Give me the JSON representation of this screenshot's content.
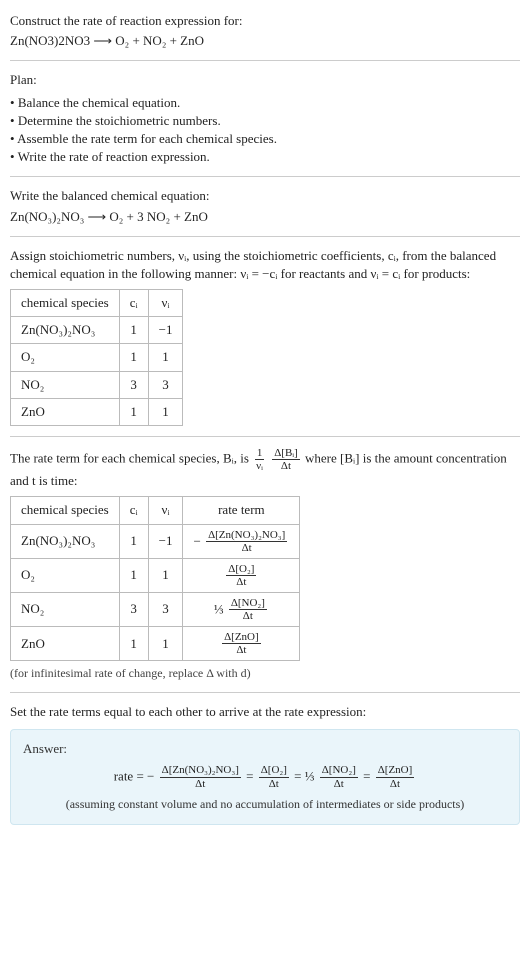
{
  "header": {
    "prompt": "Construct the rate of reaction expression for:",
    "equation_unbalanced": "Zn(NO3)2NO3  ⟶  O₂ + NO₂ + ZnO"
  },
  "plan": {
    "title": "Plan:",
    "items": [
      "Balance the chemical equation.",
      "Determine the stoichiometric numbers.",
      "Assemble the rate term for each chemical species.",
      "Write the rate of reaction expression."
    ]
  },
  "balanced": {
    "intro": "Write the balanced chemical equation:",
    "equation": "Zn(NO₃)₂NO₃  ⟶  O₂ + 3 NO₂ + ZnO"
  },
  "stoich_assign": {
    "text": "Assign stoichiometric numbers, νᵢ, using the stoichiometric coefficients, cᵢ, from the balanced chemical equation in the following manner: νᵢ = −cᵢ for reactants and νᵢ = cᵢ for products:",
    "headers": {
      "species": "chemical species",
      "ci": "cᵢ",
      "vi": "νᵢ"
    },
    "rows": [
      {
        "species": "Zn(NO₃)₂NO₃",
        "ci": "1",
        "vi": "−1"
      },
      {
        "species": "O₂",
        "ci": "1",
        "vi": "1"
      },
      {
        "species": "NO₂",
        "ci": "3",
        "vi": "3"
      },
      {
        "species": "ZnO",
        "ci": "1",
        "vi": "1"
      }
    ]
  },
  "rate_term": {
    "intro_1": "The rate term for each chemical species, Bᵢ, is ",
    "intro_2": " where [Bᵢ] is the amount concentration and t is time:",
    "frac1": {
      "num": "1",
      "den": "νᵢ"
    },
    "frac2": {
      "num": "Δ[Bᵢ]",
      "den": "Δt"
    },
    "headers": {
      "species": "chemical species",
      "ci": "cᵢ",
      "vi": "νᵢ",
      "rate": "rate term"
    },
    "rows": [
      {
        "species": "Zn(NO₃)₂NO₃",
        "ci": "1",
        "vi": "−1",
        "rate_prefix": "−",
        "rate_num": "Δ[Zn(NO₃)₂NO₃]",
        "rate_den": "Δt"
      },
      {
        "species": "O₂",
        "ci": "1",
        "vi": "1",
        "rate_prefix": "",
        "rate_num": "Δ[O₂]",
        "rate_den": "Δt"
      },
      {
        "species": "NO₂",
        "ci": "3",
        "vi": "3",
        "rate_prefix": "⅓ ",
        "rate_num": "Δ[NO₂]",
        "rate_den": "Δt"
      },
      {
        "species": "ZnO",
        "ci": "1",
        "vi": "1",
        "rate_prefix": "",
        "rate_num": "Δ[ZnO]",
        "rate_den": "Δt"
      }
    ],
    "note": "(for infinitesimal rate of change, replace Δ with d)"
  },
  "final": {
    "intro": "Set the rate terms equal to each other to arrive at the rate expression:",
    "answer_label": "Answer:",
    "rate_lead": "rate = −",
    "t1": {
      "num": "Δ[Zn(NO₃)₂NO₃]",
      "den": "Δt"
    },
    "eq1": " = ",
    "t2": {
      "num": "Δ[O₂]",
      "den": "Δt"
    },
    "eq2": " = ⅓ ",
    "t3": {
      "num": "Δ[NO₂]",
      "den": "Δt"
    },
    "eq3": " = ",
    "t4": {
      "num": "Δ[ZnO]",
      "den": "Δt"
    },
    "assumption": "(assuming constant volume and no accumulation of intermediates or side products)"
  },
  "chart_data": {
    "type": "table",
    "title": "Stoichiometric numbers and rate terms for Zn(NO3)2NO3 → O2 + 3 NO2 + ZnO",
    "columns": [
      "chemical species",
      "cᵢ",
      "νᵢ",
      "rate term"
    ],
    "rows": [
      [
        "Zn(NO₃)₂NO₃",
        1,
        -1,
        "-Δ[Zn(NO₃)₂NO₃]/Δt"
      ],
      [
        "O₂",
        1,
        1,
        "Δ[O₂]/Δt"
      ],
      [
        "NO₂",
        3,
        3,
        "(1/3) Δ[NO₂]/Δt"
      ],
      [
        "ZnO",
        1,
        1,
        "Δ[ZnO]/Δt"
      ]
    ],
    "rate_expression": "rate = -Δ[Zn(NO₃)₂NO₃]/Δt = Δ[O₂]/Δt = (1/3) Δ[NO₂]/Δt = Δ[ZnO]/Δt"
  }
}
